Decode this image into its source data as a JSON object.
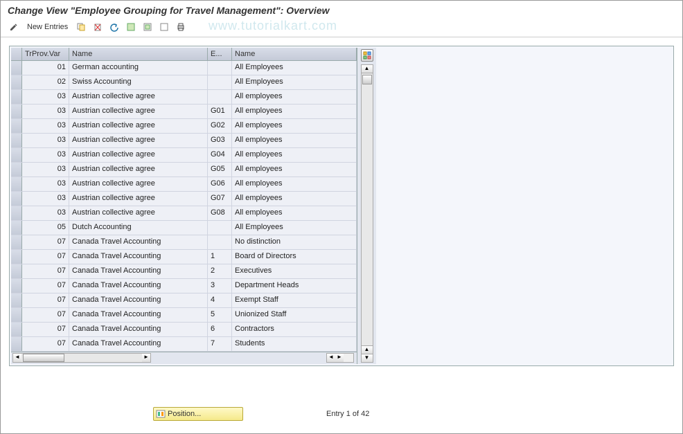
{
  "title": "Change View \"Employee Grouping for Travel Management\": Overview",
  "toolbar": {
    "new_entries_label": "New Entries"
  },
  "watermark": "www.tutorialkart.com",
  "grid": {
    "headers": {
      "sel": "",
      "trvar": "TrProv.Var",
      "name1": "Name",
      "egrp": "E...",
      "name2": "Name"
    },
    "rows": [
      {
        "trvar": "01",
        "name1": "German accounting",
        "egrp": "",
        "name2": "All Employees"
      },
      {
        "trvar": "02",
        "name1": "Swiss Accounting",
        "egrp": "",
        "name2": "All Employees"
      },
      {
        "trvar": "03",
        "name1": "Austrian collective agree",
        "egrp": "",
        "name2": "All employees"
      },
      {
        "trvar": "03",
        "name1": "Austrian collective agree",
        "egrp": "G01",
        "name2": "All employees"
      },
      {
        "trvar": "03",
        "name1": "Austrian collective agree",
        "egrp": "G02",
        "name2": "All employees"
      },
      {
        "trvar": "03",
        "name1": "Austrian collective agree",
        "egrp": "G03",
        "name2": "All employees"
      },
      {
        "trvar": "03",
        "name1": "Austrian collective agree",
        "egrp": "G04",
        "name2": "All employees"
      },
      {
        "trvar": "03",
        "name1": "Austrian collective agree",
        "egrp": "G05",
        "name2": "All employees"
      },
      {
        "trvar": "03",
        "name1": "Austrian collective agree",
        "egrp": "G06",
        "name2": "All employees"
      },
      {
        "trvar": "03",
        "name1": "Austrian collective agree",
        "egrp": "G07",
        "name2": "All employees"
      },
      {
        "trvar": "03",
        "name1": "Austrian collective agree",
        "egrp": "G08",
        "name2": "All employees"
      },
      {
        "trvar": "05",
        "name1": "Dutch Accounting",
        "egrp": "",
        "name2": "All Employees"
      },
      {
        "trvar": "07",
        "name1": "Canada Travel Accounting",
        "egrp": "",
        "name2": "No distinction"
      },
      {
        "trvar": "07",
        "name1": "Canada Travel Accounting",
        "egrp": "1",
        "name2": "Board of Directors"
      },
      {
        "trvar": "07",
        "name1": "Canada Travel Accounting",
        "egrp": "2",
        "name2": "Executives"
      },
      {
        "trvar": "07",
        "name1": "Canada Travel Accounting",
        "egrp": "3",
        "name2": "Department Heads"
      },
      {
        "trvar": "07",
        "name1": "Canada Travel Accounting",
        "egrp": "4",
        "name2": "Exempt Staff"
      },
      {
        "trvar": "07",
        "name1": "Canada Travel Accounting",
        "egrp": "5",
        "name2": "Unionized Staff"
      },
      {
        "trvar": "07",
        "name1": "Canada Travel Accounting",
        "egrp": "6",
        "name2": "Contractors"
      },
      {
        "trvar": "07",
        "name1": "Canada Travel Accounting",
        "egrp": "7",
        "name2": "Students"
      }
    ]
  },
  "footer": {
    "position_label": "Position...",
    "entry_status": "Entry 1 of 42"
  }
}
